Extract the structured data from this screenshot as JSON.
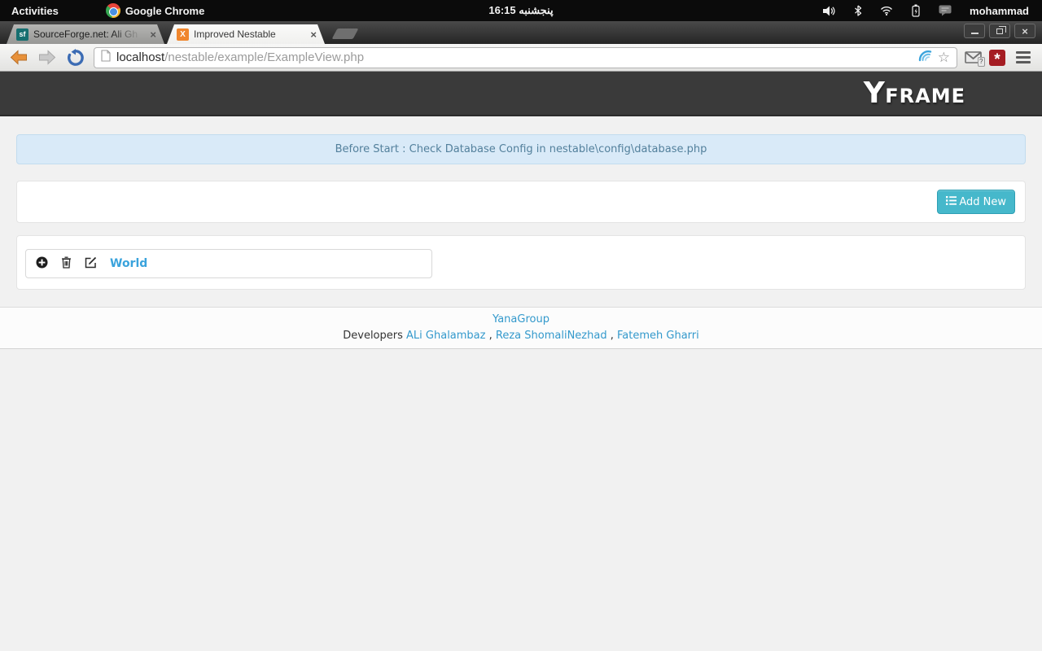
{
  "topbar": {
    "activities_label": "Activities",
    "app_name": "Google Chrome",
    "clock": "16:15 پنجشنبه",
    "username": "mohammad",
    "tray_icons": [
      "volume-icon",
      "bluetooth-icon",
      "wifi-icon",
      "battery-icon",
      "chat-icon"
    ]
  },
  "browser": {
    "tabs": [
      {
        "favicon_text": "sf",
        "title": "SourceForge.net: Ali Gh",
        "close_glyph": "×"
      },
      {
        "favicon_text": "X",
        "title": "Improved Nestable",
        "close_glyph": "×"
      }
    ],
    "window_controls": [
      "minimize",
      "restore",
      "close"
    ],
    "address": {
      "host": "localhost",
      "path": "/nestable/example/ExampleView.php"
    },
    "omnibox_icons": [
      "page-icon",
      "wave-icon",
      "bookmark-star-icon"
    ],
    "extension_icons": [
      "gmail-icon",
      "lastpass-icon"
    ],
    "lastpass_glyph": "*",
    "star_glyph": "☆"
  },
  "page": {
    "logo_first": "Y",
    "logo_rest": "FRAME",
    "alert_text": "Before Start : Check Database Config in nestable\\config\\database.php",
    "add_new_label": "Add New",
    "item_label": "World",
    "item_icons": [
      "plus-circle-icon",
      "trash-icon",
      "edit-icon"
    ],
    "footer": {
      "group_link": "YanaGroup",
      "developers_label": "Developers",
      "dev1": "ALi Ghalambaz",
      "dev2": "Reza ShomaliNezhad",
      "dev3": "Fatemeh Gharri",
      "comma": ","
    }
  },
  "colors": {
    "accent_teal": "#46b8cb",
    "link_blue": "#3399cc",
    "item_link_blue": "#3aa3dc",
    "alert_bg": "#d9eaf8",
    "alert_text": "#53809c",
    "site_header_bg": "#3a3a3a",
    "topbar_bg": "#0b0b0b"
  }
}
